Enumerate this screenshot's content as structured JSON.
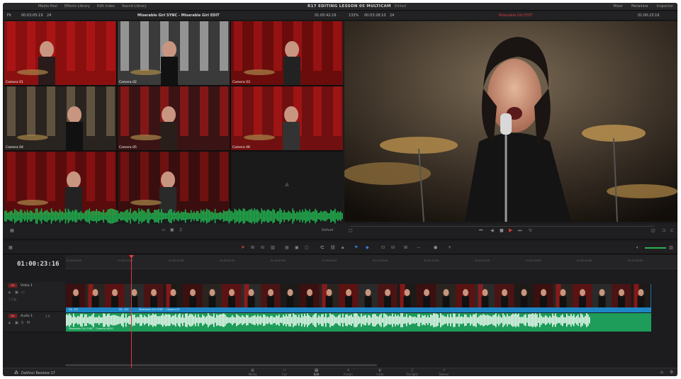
{
  "topbar": {
    "nav": [
      "Media Pool",
      "Effects Library",
      "Edit Index",
      "Sound Library"
    ],
    "title": "R17 EDITING LESSON 05 MULTICAM",
    "subtitle": "Edited",
    "right": [
      "Mixer",
      "Metadata",
      "Inspector"
    ]
  },
  "infobar": {
    "fit": "Fit",
    "duration": "00:03:05:19",
    "fps": "24",
    "source_title": "Miserable Girl SYNC - Miserable Girl EDIT",
    "source_tc": "01:00:42:16",
    "zoom": "133%",
    "rec_duration": "00:03:28:10",
    "rec_fps": "24",
    "timeline_name": "Miserable Girl EDIT",
    "rec_tc": "01:00:23:16"
  },
  "multicam": {
    "angles": [
      "Camera 01",
      "Camera 02",
      "Camera 03",
      "Camera 04",
      "Camera 05",
      "Camera 06",
      "",
      "",
      ""
    ],
    "selected_index": 1
  },
  "controls": {
    "default_label": "Default"
  },
  "timeline": {
    "timecode": "01:00:23:16",
    "ruler": [
      "01:00:00:00",
      "01:00:10:00",
      "01:00:20:00",
      "01:00:30:00",
      "01:00:40:00",
      "01:00:50:00",
      "01:01:00:00",
      "01:01:10:00",
      "01:01:20:00",
      "01:01:30:00",
      "01:01:40:00",
      "01:01:50:00"
    ],
    "tracks": {
      "video": {
        "tag": "V1",
        "name": "Video 1",
        "clips": "1 Clip"
      },
      "audio": {
        "tag": "A1",
        "name": "Audio 1",
        "level": "2.0"
      }
    },
    "video_clip_labels": [
      "V4...D3",
      "V4...D3",
      "Miserable Girl SYNC - Camera 02"
    ],
    "audio_clip_label": "Miserable Girl SYNC - Camera 06/01"
  },
  "bottombar": {
    "brand": "DaVinci Resolve 17",
    "pages": [
      {
        "icon": "▦",
        "label": "Media"
      },
      {
        "icon": "✂",
        "label": "Cut"
      },
      {
        "icon": "▤",
        "label": "Edit"
      },
      {
        "icon": "✦",
        "label": "Fusion"
      },
      {
        "icon": "◐",
        "label": "Color"
      },
      {
        "icon": "♫",
        "label": "Fairlight"
      },
      {
        "icon": "➚",
        "label": "Deliver"
      }
    ],
    "active_page": 2
  }
}
